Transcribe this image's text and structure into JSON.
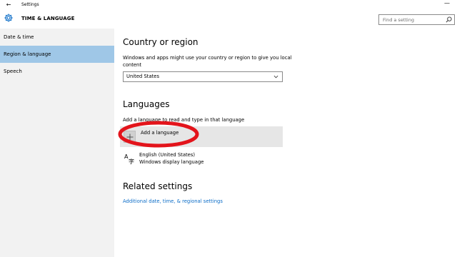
{
  "window": {
    "title": "Settings",
    "back_glyph": "←",
    "minimize_glyph": "—"
  },
  "header": {
    "section_title": "TIME & LANGUAGE",
    "search_placeholder": "Find a setting",
    "icon": "gear-icon"
  },
  "sidebar": {
    "items": [
      {
        "label": "Date & time",
        "active": false
      },
      {
        "label": "Region & language",
        "active": true
      },
      {
        "label": "Speech",
        "active": false
      }
    ],
    "active_color": "#9fc7e7"
  },
  "main": {
    "country": {
      "heading": "Country or region",
      "description": "Windows and apps might use your country or region to give you local content",
      "selected": "United States"
    },
    "languages": {
      "heading": "Languages",
      "description": "Add a language to read and type in that language",
      "add_label": "Add a language",
      "items": [
        {
          "name": "English (United States)",
          "sub": "Windows display language"
        }
      ]
    },
    "related": {
      "heading": "Related settings",
      "link": "Additional date, time, & regional settings"
    }
  },
  "colors": {
    "link": "#0a6cc7",
    "annotation": "#e3141b",
    "sidebar_bg": "#f2f2f2"
  }
}
